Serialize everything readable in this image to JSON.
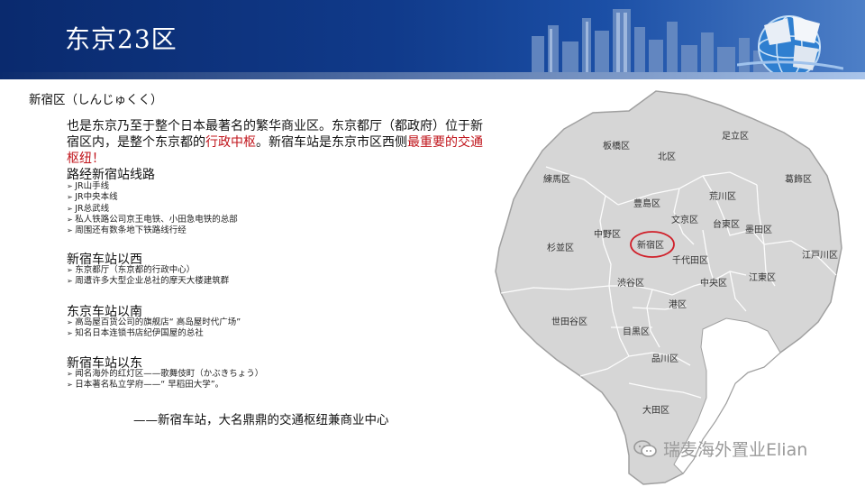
{
  "header": {
    "title": "东京23区"
  },
  "subtitle": "新宿区（しんじゅくく）",
  "intro": {
    "part1": "也是东京乃至于整个日本最著名的繁华商业区。东京都厅（都政府）位于新宿区内，是整个东京都的",
    "highlight1": "行政中枢",
    "part2": "。新宿车站是东京市区西侧",
    "highlight2": "最重要的交通枢纽！",
    "line_title": "路经新宿站线路"
  },
  "lines": [
    "JR山手线",
    "JR中央本线",
    "JR总武线",
    "私人铁路公司京王电铁、小田急电铁的总部",
    "周围还有数条地下铁路线行经"
  ],
  "west": {
    "title": "新宿车站以西",
    "items": [
      "东京都厅（东京都的行政中心）",
      "周遭许多大型企业总社的摩天大楼建筑群"
    ]
  },
  "south": {
    "title": "东京车站以南",
    "items": [
      "高岛屋百货公司的旗舰店“ 高岛屋时代广场”",
      "知名日本连锁书店纪伊国屋的总社"
    ]
  },
  "east": {
    "title": "新宿车站以东",
    "items": [
      "闻名海外的红灯区——歌舞伎町（かぶきちょう）",
      "日本著名私立学府——“ 早稻田大学”。"
    ]
  },
  "summary": "——新宿车站，大名鼎鼎的交通枢纽兼商业中心",
  "map": {
    "labels": {
      "adachi": "足立区",
      "itabashi": "板橋区",
      "kita": "北区",
      "nerima": "練馬区",
      "katsushika": "葛飾区",
      "arakawa": "荒川区",
      "toshima": "豊島区",
      "bunkyo": "文京区",
      "taito": "台東区",
      "sumida": "墨田区",
      "nakano": "中野区",
      "shinjuku": "新宿区",
      "suginami": "杉並区",
      "edogawa": "江戸川区",
      "chiyoda": "千代田区",
      "chuo": "中央区",
      "koto": "江東区",
      "shibuya": "渋谷区",
      "minato": "港区",
      "setagaya": "世田谷区",
      "meguro": "目黒区",
      "shinagawa": "品川区",
      "ota": "大田区"
    },
    "highlight_color": "#d0202a"
  },
  "watermark": "瑞麦海外置业Elian",
  "colors": {
    "header": "#0a2a6e",
    "accent": "#c0141b"
  }
}
